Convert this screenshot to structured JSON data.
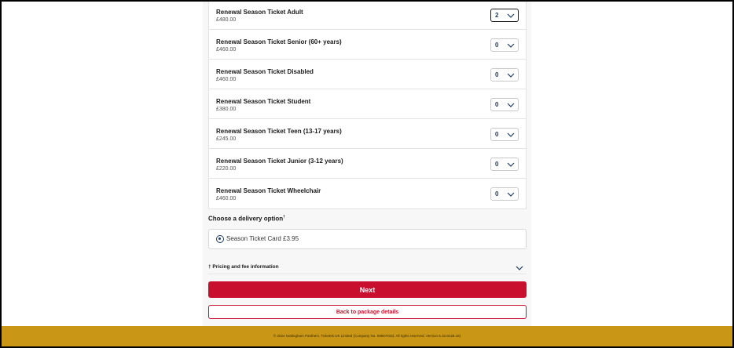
{
  "tickets": [
    {
      "name": "Renewal Season Ticket Adult",
      "price": "£480.00",
      "qty": "2"
    },
    {
      "name": "Renewal Season Ticket Senior (60+ years)",
      "price": "£460.00",
      "qty": "0"
    },
    {
      "name": "Renewal Season Ticket Disabled",
      "price": "£460.00",
      "qty": "0"
    },
    {
      "name": "Renewal Season Ticket Student",
      "price": "£380.00",
      "qty": "0"
    },
    {
      "name": "Renewal Season Ticket Teen (13-17 years)",
      "price": "£245.00",
      "qty": "0"
    },
    {
      "name": "Renewal Season Ticket Junior (3-12 years)",
      "price": "£220.00",
      "qty": "0"
    },
    {
      "name": "Renewal Season Ticket Wheelchair",
      "price": "£460.00",
      "qty": "0"
    }
  ],
  "delivery": {
    "title": "Choose a delivery option",
    "marker": "†",
    "option_label": "Season Ticket Card £3.95",
    "selected": true
  },
  "pricing": {
    "label": "† Pricing and fee information"
  },
  "buttons": {
    "next_label": "Next",
    "back_label": "Back to package details"
  },
  "footer": {
    "text": "© 2024 Nottingham Panthers. Ticketek UK Limited (Company No. 09667015). All rights reserved. Version 5.32.8128.16)"
  },
  "colors": {
    "primary": "#c8102e",
    "footer_bg": "#c99615",
    "accent_navy": "#1f3a5f"
  },
  "icons": {
    "quantity_dropdown": "chevron-down-icon",
    "pricing_expand": "chevron-down-icon"
  }
}
